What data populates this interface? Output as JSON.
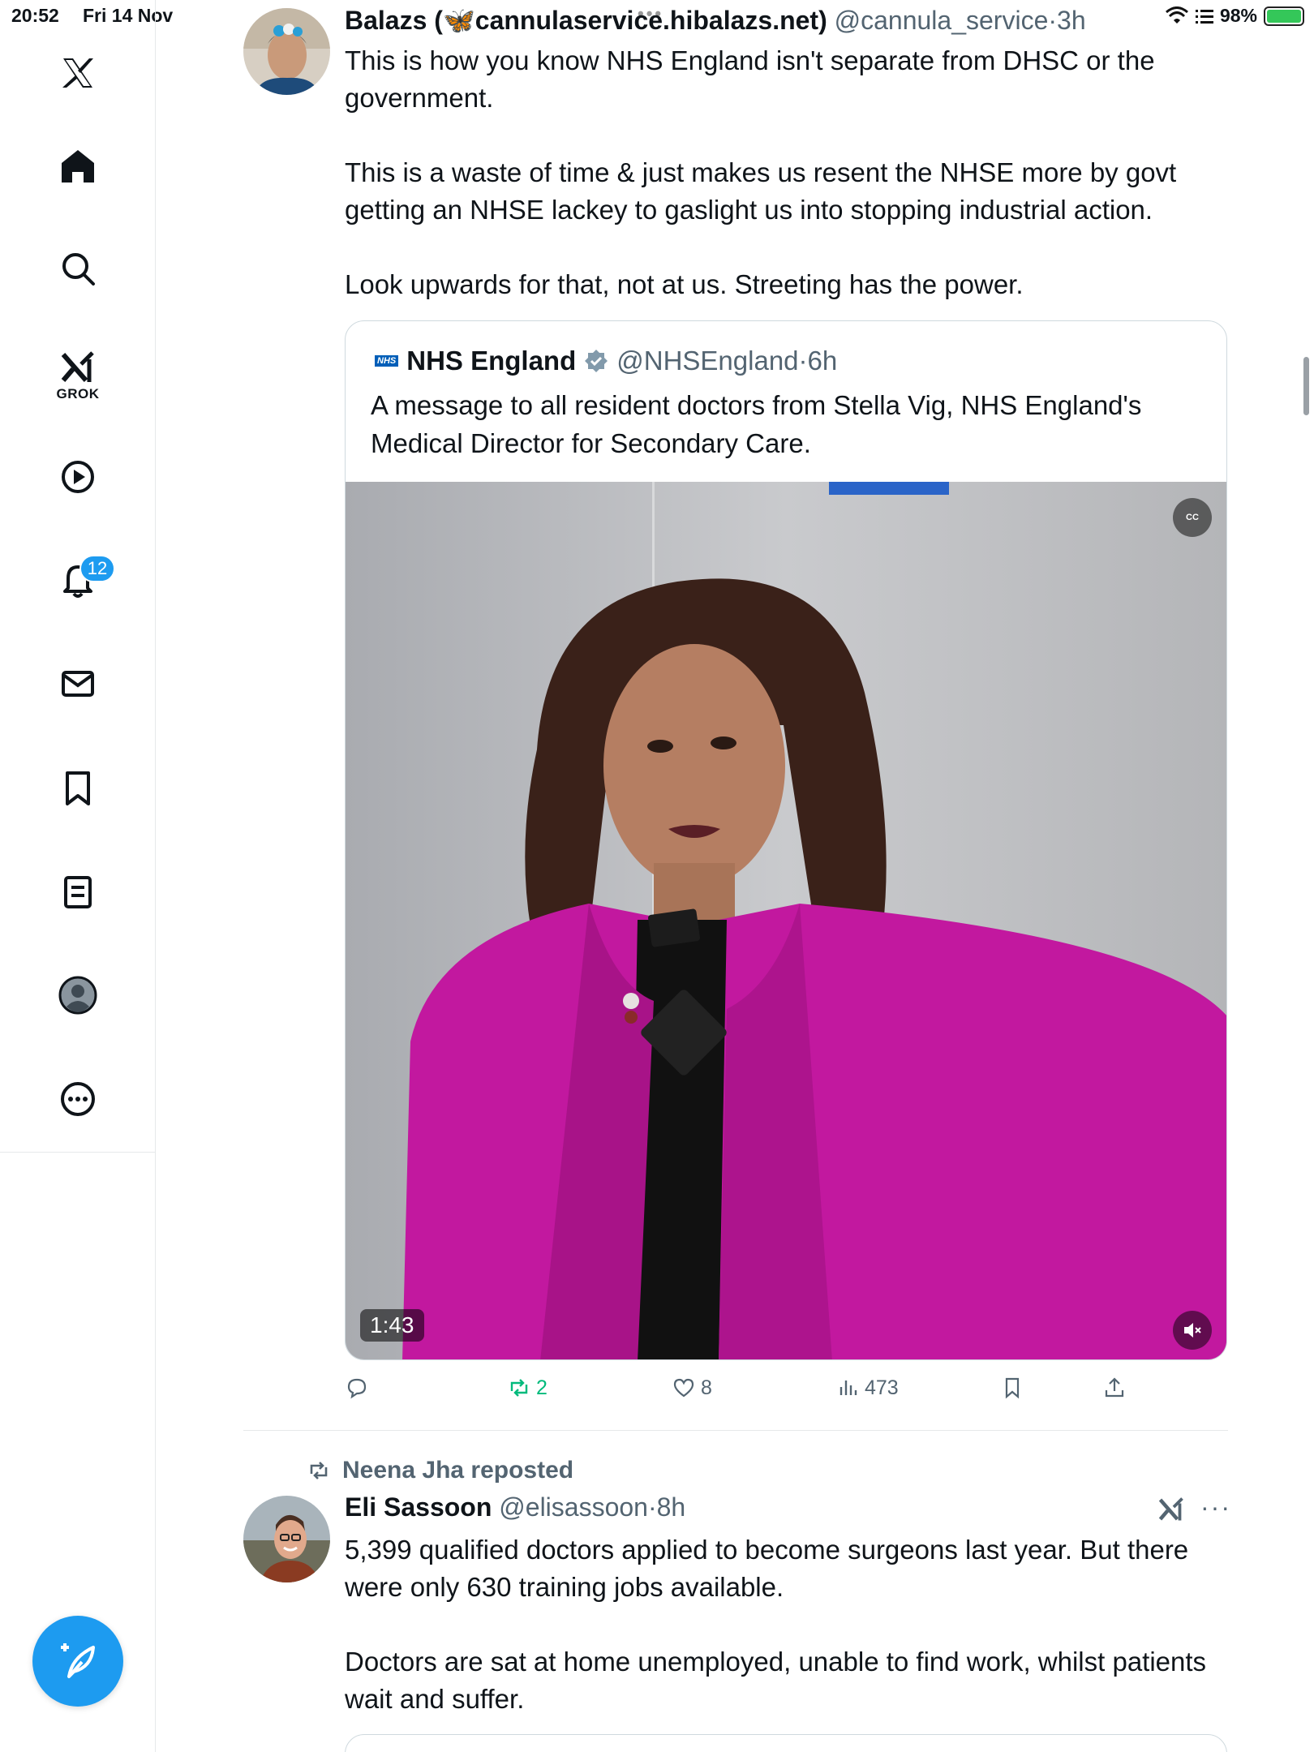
{
  "status_bar": {
    "time": "20:52",
    "date": "Fri 14 Nov",
    "battery": "98%",
    "battery_level": 0.98
  },
  "sidebar": {
    "grok_label": "GROK",
    "notifications_count": "12",
    "icons": [
      "x-logo-icon",
      "home-icon",
      "search-icon",
      "grok-icon",
      "video-icon",
      "bell-icon",
      "mail-icon",
      "bookmark-icon",
      "lists-icon",
      "profile-icon",
      "more-icon",
      "compose-icon"
    ]
  },
  "tweet1": {
    "name_prefix": "Balazs (",
    "name_domain": "cannulaservice.hibalazs.net)",
    "handle": "@cannula_service",
    "sep": "·",
    "time": "3h",
    "paragraphs": [
      "This is how you know NHS England isn't separate from DHSC or the government.",
      "This is a waste of time & just makes us resent the NHSE more by govt getting an NHSE lackey to gaslight us into stopping industrial action.",
      "Look upwards for that, not at us. Streeting has the power."
    ],
    "quote": {
      "logo_text": "NHS",
      "name": "NHS England",
      "handle": "@NHSEngland",
      "sep": "·",
      "time": "6h",
      "text": "A message to all resident doctors from Stella Vig, NHS England's Medical Director for Secondary Care.",
      "video_duration": "1:43",
      "cc_label": "CC"
    },
    "actions": {
      "reposts": "2",
      "likes": "8",
      "views": "473"
    },
    "colors": {
      "repost_active": "#00ba7c",
      "accent": "#1d9bf0"
    }
  },
  "tweet2": {
    "reposted_by": "Neena Jha reposted",
    "name": "Eli Sassoon",
    "handle": "@elisassoon",
    "sep": "·",
    "time": "8h",
    "more": "···",
    "paragraphs": [
      "5,399 qualified doctors applied to become surgeons last year. But there were only 630 training jobs available.",
      "Doctors are sat at home unemployed, unable to find work, whilst patients wait and suffer."
    ]
  }
}
